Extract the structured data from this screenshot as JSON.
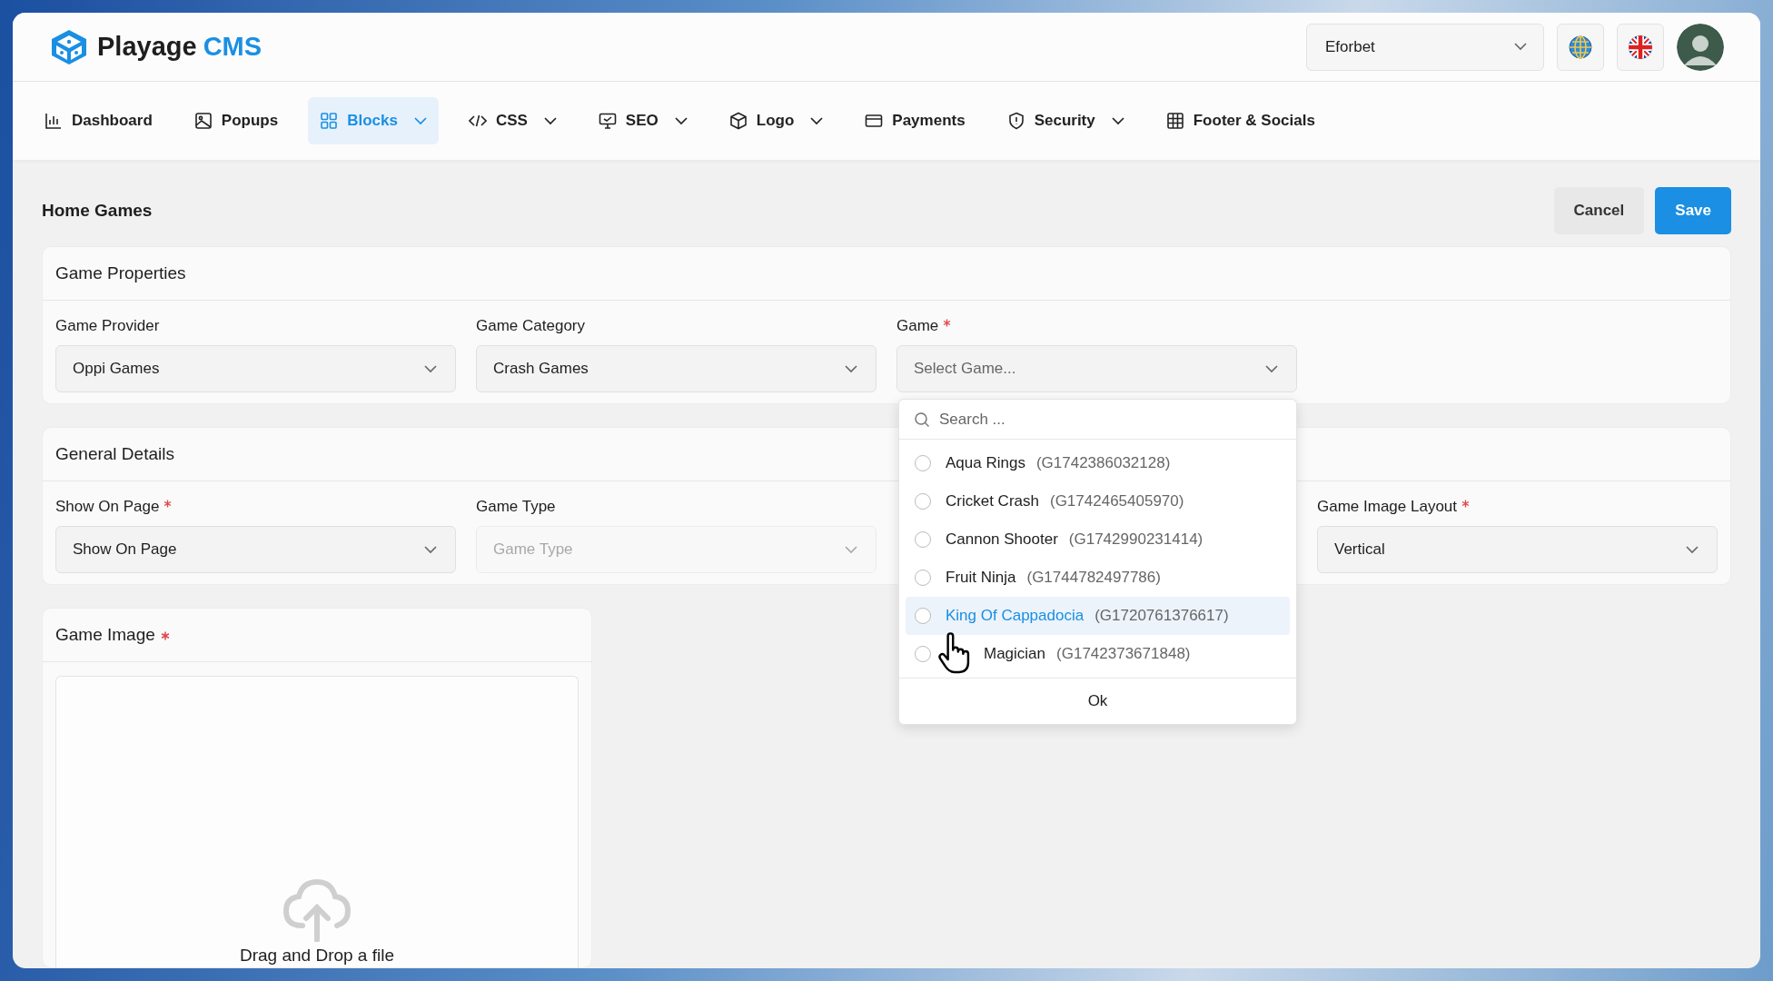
{
  "app": {
    "brand": "Playage",
    "brand_suffix": "CMS"
  },
  "site_select": {
    "value": "Eforbet"
  },
  "nav": [
    {
      "label": "Dashboard",
      "selected": false,
      "has_menu": false
    },
    {
      "label": "Popups",
      "selected": false,
      "has_menu": false
    },
    {
      "label": "Blocks",
      "selected": true,
      "has_menu": true
    },
    {
      "label": "CSS",
      "selected": false,
      "has_menu": true
    },
    {
      "label": "SEO",
      "selected": false,
      "has_menu": true
    },
    {
      "label": "Logo",
      "selected": false,
      "has_menu": true
    },
    {
      "label": "Payments",
      "selected": false,
      "has_menu": false
    },
    {
      "label": "Security",
      "selected": false,
      "has_menu": true
    },
    {
      "label": "Footer & Socials",
      "selected": false,
      "has_menu": false
    }
  ],
  "page": {
    "title": "Home Games",
    "buttons": [
      {
        "label": "Cancel",
        "kind": "secondary"
      },
      {
        "label": "Save",
        "kind": "primary"
      }
    ]
  },
  "sections": [
    {
      "title": "Game Properties",
      "fields": [
        {
          "label": "Game Provider",
          "required": false,
          "value": "Oppi Games",
          "disabled": false,
          "open": false
        },
        {
          "label": "Game Category",
          "required": false,
          "value": "Crash Games",
          "disabled": false,
          "open": false
        },
        {
          "label": "Game",
          "required": true,
          "placeholder": "Select Game...",
          "disabled": false,
          "open": true
        }
      ]
    },
    {
      "title": "General Details",
      "fields": [
        {
          "label": "Show On Page",
          "required": true,
          "value": "Show On Page",
          "disabled": false,
          "open": false
        },
        {
          "label": "Game Type",
          "required": false,
          "placeholder": "Game Type",
          "disabled": true,
          "open": false
        },
        {
          "label": "Game Image Layout",
          "required": true,
          "value": "Vertical",
          "disabled": false,
          "open": false
        }
      ]
    }
  ],
  "dropdown": {
    "search_placeholder": "Search ...",
    "ok": "Ok",
    "options": [
      {
        "name": "Aqua Rings",
        "code": "(G1742386032128)",
        "selected": false,
        "hovered": false
      },
      {
        "name": "Cricket Crash",
        "code": "(G1742465405970)",
        "selected": false,
        "hovered": false
      },
      {
        "name": "Cannon Shooter",
        "code": "(G1742990231414)",
        "selected": false,
        "hovered": false
      },
      {
        "name": "Fruit Ninja",
        "code": "(G1744782497786)",
        "selected": false,
        "hovered": false
      },
      {
        "name": "King Of Cappadocia",
        "code": "(G1720761376617)",
        "selected": false,
        "hovered": true
      },
      {
        "name": "Magician",
        "code": "(G1742373671848)",
        "selected": false,
        "hovered": false
      }
    ]
  },
  "image_section": {
    "title": "Game Image",
    "required": true,
    "upload_text": "Drag and Drop a file"
  }
}
